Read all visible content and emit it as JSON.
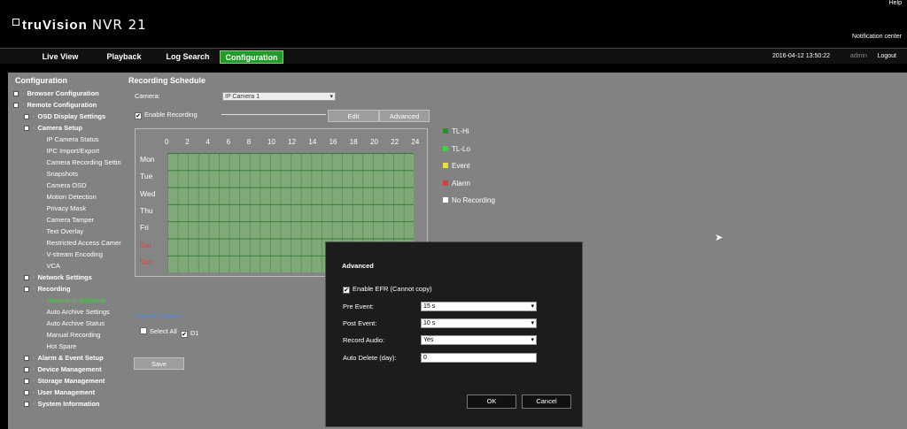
{
  "header": {
    "logo_brand": "truVision",
    "logo_model": "NVR 21",
    "help": "Help",
    "notification": "Notification center"
  },
  "nav": {
    "tabs": [
      "Live View",
      "Playback",
      "Log Search",
      "Configuration"
    ],
    "active": "Configuration",
    "datetime": "2016-04-12 13:50:22",
    "user": "admin",
    "logout": "Logout"
  },
  "sidebar": {
    "title": "Configuration",
    "items": [
      {
        "label": "Browser Configuration",
        "level": 0,
        "box": true
      },
      {
        "label": "Remote Configuration",
        "level": 0,
        "box": true
      },
      {
        "label": "OSD Display Settings",
        "level": 1,
        "box": true
      },
      {
        "label": "Camera Setup",
        "level": 1,
        "box": true
      },
      {
        "label": "IP Camera Status",
        "level": 2
      },
      {
        "label": "IPC Import/Export",
        "level": 2
      },
      {
        "label": "Camera Recording Settings",
        "level": 2
      },
      {
        "label": "Snapshots",
        "level": 2
      },
      {
        "label": "Camera OSD",
        "level": 2
      },
      {
        "label": "Motion Detection",
        "level": 2
      },
      {
        "label": "Privacy Mask",
        "level": 2
      },
      {
        "label": "Camera Tamper",
        "level": 2
      },
      {
        "label": "Text Overlay",
        "level": 2
      },
      {
        "label": "Restricted Access Camera",
        "level": 2
      },
      {
        "label": "V-stream Encoding",
        "level": 2
      },
      {
        "label": "VCA",
        "level": 2
      },
      {
        "label": "Network Settings",
        "level": 1,
        "box": true
      },
      {
        "label": "Recording",
        "level": 1,
        "box": true
      },
      {
        "label": "Recording Schedule",
        "level": 2,
        "selected": true
      },
      {
        "label": "Auto Archive Settings",
        "level": 2
      },
      {
        "label": "Auto Archive Status",
        "level": 2
      },
      {
        "label": "Manual Recording",
        "level": 2
      },
      {
        "label": "Hot Spare",
        "level": 2
      },
      {
        "label": "Alarm & Event Setup",
        "level": 1,
        "box": true
      },
      {
        "label": "Device Management",
        "level": 1,
        "box": true
      },
      {
        "label": "Storage Management",
        "level": 1,
        "box": true
      },
      {
        "label": "User Management",
        "level": 1,
        "box": true
      },
      {
        "label": "System Information",
        "level": 1,
        "box": true
      }
    ]
  },
  "content": {
    "title": "Recording Schedule",
    "camera_label": "Camera:",
    "camera_value": "IP Camera 1",
    "enable_recording": "Enable Recording",
    "edit": "Edit",
    "advanced": "Advanced",
    "hours": [
      "0",
      "2",
      "4",
      "6",
      "8",
      "10",
      "12",
      "14",
      "16",
      "18",
      "20",
      "22",
      "24"
    ],
    "days": [
      "Mon",
      "Tue",
      "Wed",
      "Thu",
      "Fri",
      "Sat",
      "Sun"
    ],
    "legend": [
      {
        "label": "TL-Hi",
        "color": "#2e8b2e"
      },
      {
        "label": "TL-Lo",
        "color": "#3fd13f"
      },
      {
        "label": "Event",
        "color": "#e8e040"
      },
      {
        "label": "Alarm",
        "color": "#d04040"
      },
      {
        "label": "No Recording",
        "color": "#ffffff"
      }
    ],
    "copy_to_camera": "Copy to Camera",
    "select_all": "Select All",
    "d1": "D1",
    "save": "Save"
  },
  "dialog": {
    "title": "Advanced",
    "enable_efr": "Enable EFR (Cannot copy)",
    "pre_event_label": "Pre Event:",
    "pre_event": "15 s",
    "post_event_label": "Post Event:",
    "post_event": "10 s",
    "record_audio_label": "Record Audio:",
    "record_audio": "Yes",
    "auto_delete_label": "Auto Delete (day):",
    "auto_delete": "0",
    "ok": "OK",
    "cancel": "Cancel"
  }
}
